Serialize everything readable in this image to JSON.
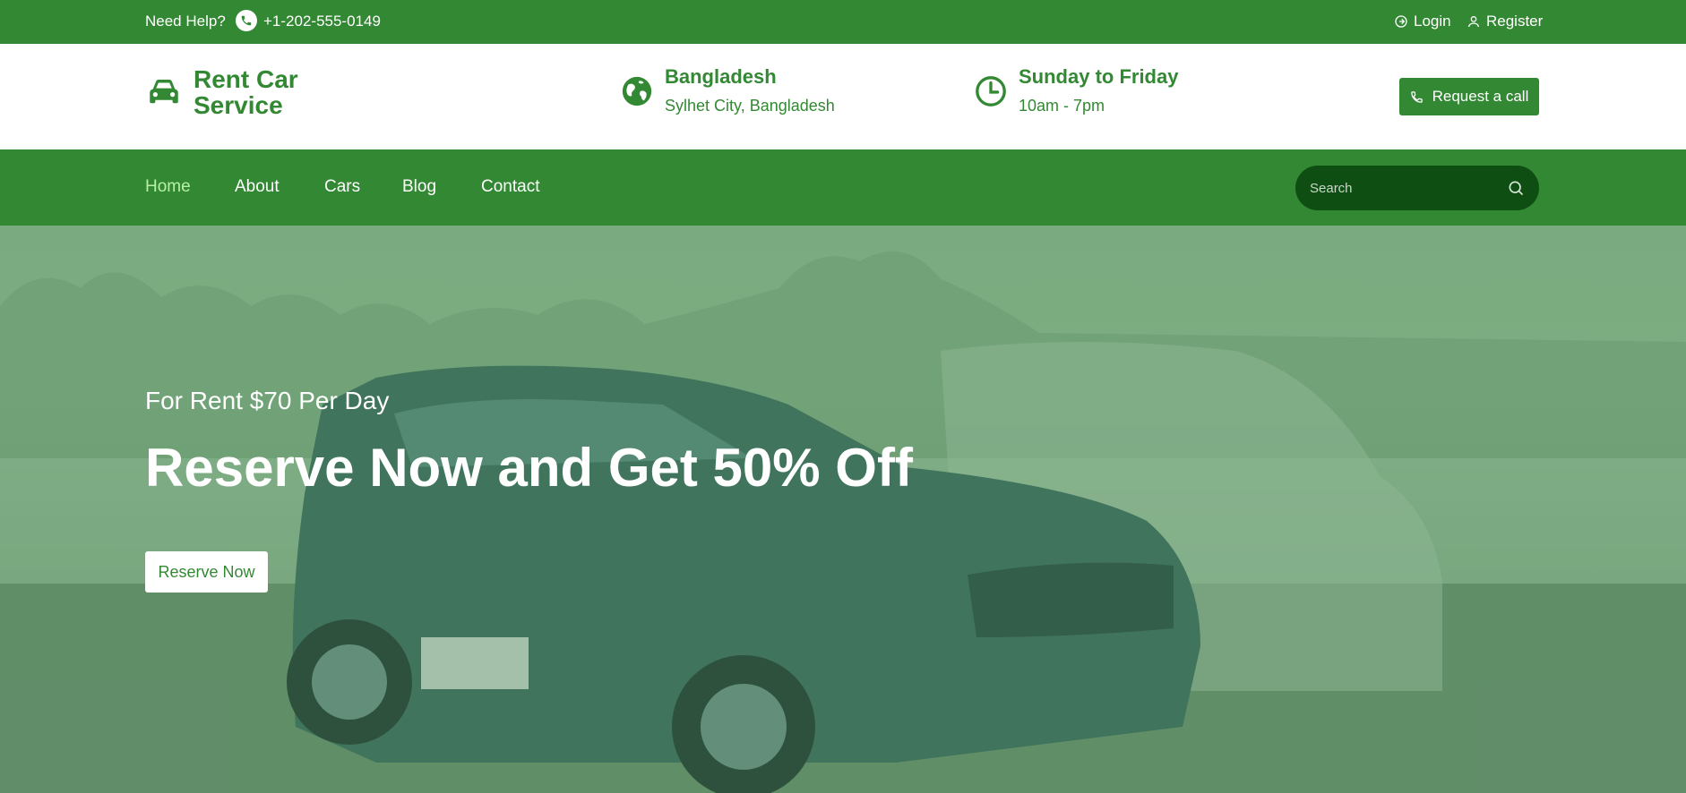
{
  "topbar": {
    "help_text": "Need Help?",
    "phone": "+1-202-555-0149",
    "login": "Login",
    "register": "Register"
  },
  "brand": {
    "name": "Rent Car Service",
    "icon": "car-icon"
  },
  "location": {
    "title": "Bangladesh",
    "subtitle": "Sylhet City, Bangladesh",
    "icon": "globe-icon"
  },
  "hours": {
    "title": "Sunday to Friday",
    "subtitle": "10am - 7pm",
    "icon": "clock-icon"
  },
  "request_call": {
    "label": "Request a call"
  },
  "nav": {
    "items": [
      "Home",
      "About",
      "Cars",
      "Blog",
      "Contact"
    ],
    "active": "Home"
  },
  "search": {
    "placeholder": "Search"
  },
  "hero": {
    "subtitle": "For Rent $70 Per Day",
    "headline": "Reserve Now and Get 50% Off",
    "button": "Reserve Now"
  },
  "colors": {
    "primary": "#338833",
    "search_bg": "#0e4e12",
    "active_nav": "#b8f0a8"
  }
}
